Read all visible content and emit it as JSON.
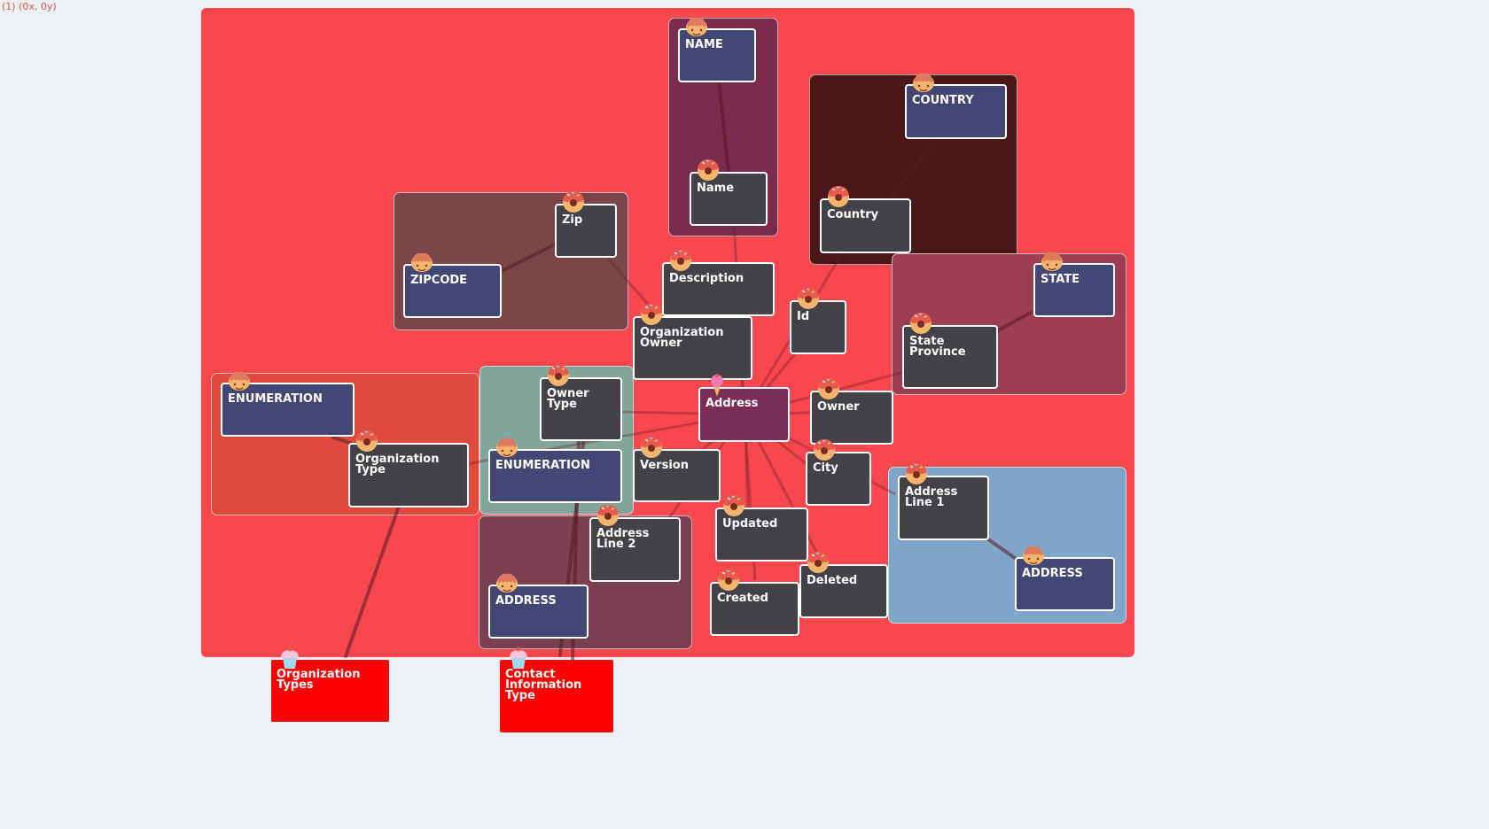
{
  "coord_readout": "(1) (0x, 0y)",
  "colors": {
    "board": "#f9484d",
    "field_node": "#454247",
    "enum_node": "#424773",
    "focus_node": "#7a2e56",
    "external_node": "#ff0000"
  },
  "nodes": {
    "name_enum": "NAME",
    "name": "Name",
    "country_enum": "COUNTRY",
    "country": "Country",
    "zip": "Zip",
    "zipcode_enum": "ZIPCODE",
    "description": "Description",
    "id": "Id",
    "state_enum": "STATE",
    "state_province": "State Province",
    "organization_owner": "Organization Owner",
    "address": "Address",
    "owner": "Owner",
    "enumeration_left": "ENUMERATION",
    "organization_type": "Organization Type",
    "owner_type": "Owner Type",
    "enumeration_mid": "ENUMERATION",
    "version": "Version",
    "city": "City",
    "address_line_1": "Address Line 1",
    "address_enum_right": "ADDRESS",
    "address_line_2": "Address Line 2",
    "updated": "Updated",
    "address_enum_left": "ADDRESS",
    "created": "Created",
    "deleted": "Deleted",
    "organization_types": "Organization Types",
    "contact_information_type": "Contact Information Type"
  },
  "icons": {
    "field": "donut-icon",
    "enum": "pretzel-icon",
    "focus": "ice-cream-icon",
    "external": "cupcake-icon"
  }
}
